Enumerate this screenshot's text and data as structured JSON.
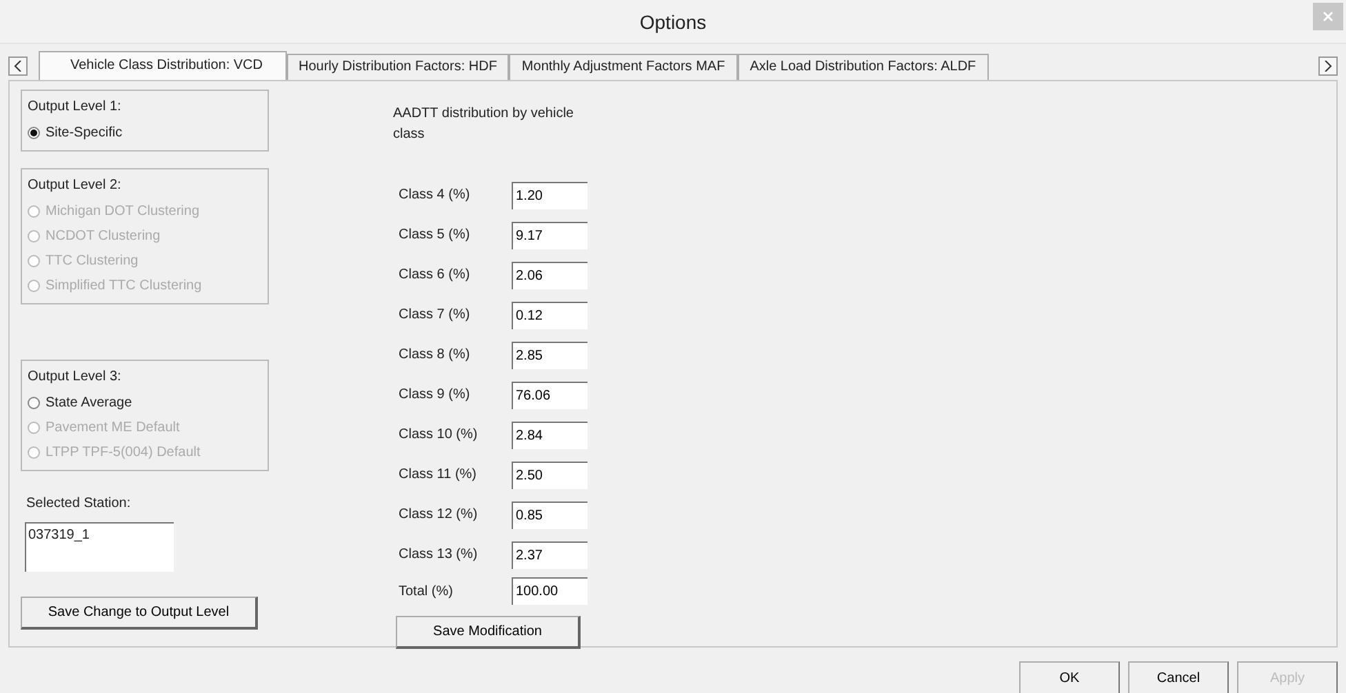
{
  "window": {
    "title": "Options"
  },
  "tabs": [
    {
      "label": "Vehicle Class Distribution: VCD",
      "selected": true
    },
    {
      "label": "Hourly Distribution Factors: HDF",
      "selected": false
    },
    {
      "label": "Monthly Adjustment Factors MAF",
      "selected": false
    },
    {
      "label": "Axle Load Distribution Factors: ALDF",
      "selected": false
    }
  ],
  "output_levels": [
    {
      "title": "Output Level 1:",
      "options": [
        {
          "label": "Site-Specific",
          "selected": true,
          "disabled": false
        }
      ]
    },
    {
      "title": "Output Level 2:",
      "options": [
        {
          "label": "Michigan DOT Clustering",
          "selected": false,
          "disabled": true
        },
        {
          "label": "NCDOT Clustering",
          "selected": false,
          "disabled": true
        },
        {
          "label": "TTC Clustering",
          "selected": false,
          "disabled": true
        },
        {
          "label": "Simplified TTC Clustering",
          "selected": false,
          "disabled": true
        }
      ]
    },
    {
      "title": "Output Level 3:",
      "options": [
        {
          "label": "State Average",
          "selected": false,
          "disabled": false
        },
        {
          "label": "Pavement ME Default",
          "selected": false,
          "disabled": true
        },
        {
          "label": "LTPP TPF-5(004) Default",
          "selected": false,
          "disabled": true
        }
      ]
    }
  ],
  "station": {
    "label": "Selected Station:",
    "value": "037319_1"
  },
  "save_level_button": "Save Change to Output Level",
  "distribution": {
    "heading": "AADTT distribution by vehicle class",
    "rows": [
      {
        "label": "Class 4 (%)",
        "value": "1.20"
      },
      {
        "label": "Class 5 (%)",
        "value": "9.17"
      },
      {
        "label": "Class 6 (%)",
        "value": "2.06"
      },
      {
        "label": "Class 7 (%)",
        "value": "0.12"
      },
      {
        "label": "Class 8 (%)",
        "value": "2.85"
      },
      {
        "label": "Class 9 (%)",
        "value": "76.06"
      },
      {
        "label": "Class 10 (%)",
        "value": "2.84"
      },
      {
        "label": "Class 11 (%)",
        "value": "2.50"
      },
      {
        "label": "Class 12 (%)",
        "value": "0.85"
      },
      {
        "label": "Class 13 (%)",
        "value": "2.37"
      },
      {
        "label": "Total (%)",
        "value": "100.00"
      }
    ],
    "save_button": "Save Modification"
  },
  "footer_buttons": [
    {
      "label": "OK",
      "disabled": false
    },
    {
      "label": "Cancel",
      "disabled": false
    },
    {
      "label": "Apply",
      "disabled": true
    }
  ]
}
